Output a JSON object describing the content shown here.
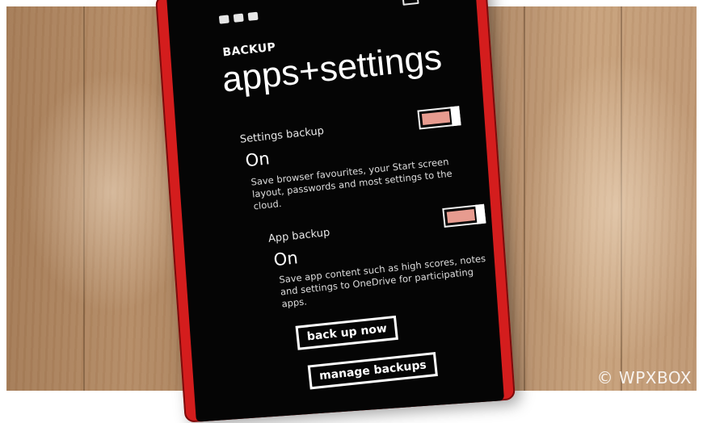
{
  "screen": {
    "kicker": "BACKUP",
    "title": "apps+settings",
    "settings_backup": {
      "label": "Settings backup",
      "value": "On",
      "description": "Save browser favourites, your Start screen layout, passwords and most settings to the cloud."
    },
    "app_backup": {
      "label": "App backup",
      "value": "On",
      "description": "Save app content such as high scores, notes and settings to OneDrive for participating apps."
    },
    "buttons": {
      "back_up_now": "back up now",
      "manage_backups": "manage backups"
    }
  },
  "watermark": "© WPXBOX",
  "colors": {
    "phone_frame": "#d41d1d",
    "screen": "#050505",
    "toggle_fill": "#e79b8f",
    "text": "#ffffff"
  },
  "icons": [
    "signal-icon",
    "wifi-icon",
    "message-icon",
    "battery-icon"
  ]
}
